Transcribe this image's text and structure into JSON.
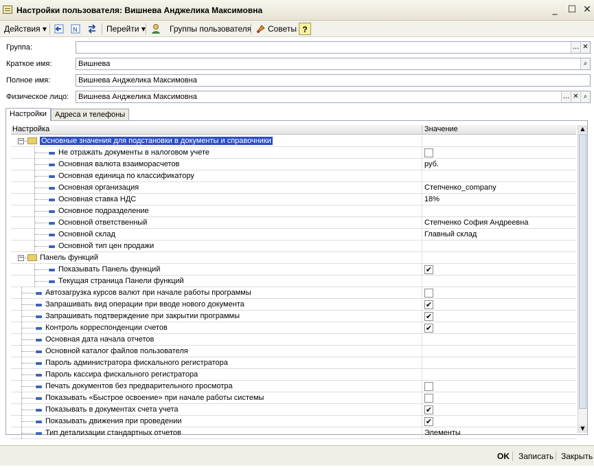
{
  "window": {
    "title": "Настройки пользователя: Вишнева Анджелика Максимовна"
  },
  "toolbar": {
    "actions": "Действия",
    "goto": "Перейти",
    "user_groups": "Группы пользователя",
    "tips": "Советы",
    "help": "?"
  },
  "form": {
    "group": {
      "label": "Группа:",
      "value": ""
    },
    "short_name": {
      "label": "Краткое имя:",
      "value": "Вишнева"
    },
    "full_name": {
      "label": "Полное имя:",
      "value": "Вишнева Анджелика Максимовна"
    },
    "person": {
      "label": "Физическое лицо:",
      "value": "Вишнева Анджелика Максимовна"
    }
  },
  "tabs": [
    "Настройки",
    "Адреса и телефоны"
  ],
  "grid": {
    "columns": [
      "Настройка",
      "Значение"
    ],
    "rows": [
      {
        "name": "Основные значения для подстановки в документы и справочники",
        "value": "",
        "check": null
      },
      {
        "name": "Не отражать документы в налоговом учете",
        "value": "",
        "check": false
      },
      {
        "name": "Основная валюта взаиморасчетов",
        "value": "руб.",
        "check": null
      },
      {
        "name": "Основная единица по классификатору",
        "value": "",
        "check": null
      },
      {
        "name": "Основная организация",
        "value": "Степченко_company",
        "check": null
      },
      {
        "name": "Основная ставка НДС",
        "value": "18%",
        "check": null
      },
      {
        "name": "Основное подразделение",
        "value": "",
        "check": null
      },
      {
        "name": "Основной ответственный",
        "value": "Степченко София Андреевна",
        "check": null
      },
      {
        "name": "Основной склад",
        "value": "Главный склад",
        "check": null
      },
      {
        "name": "Основной тип цен продажи",
        "value": "",
        "check": null
      },
      {
        "name": "Панель функций",
        "value": "",
        "check": null
      },
      {
        "name": "Показывать Панель функций",
        "value": "",
        "check": true
      },
      {
        "name": "Текущая страница Панели функций",
        "value": "",
        "check": null
      },
      {
        "name": "Автозагрузка курсов валют при начале работы программы",
        "value": "",
        "check": false
      },
      {
        "name": "Запрашивать вид операции при вводе нового документа",
        "value": "",
        "check": true
      },
      {
        "name": "Запрашивать подтверждение при закрытии программы",
        "value": "",
        "check": true
      },
      {
        "name": "Контроль корреспонденции счетов",
        "value": "",
        "check": true
      },
      {
        "name": "Основная дата начала отчетов",
        "value": "",
        "check": null
      },
      {
        "name": "Основной каталог файлов пользователя",
        "value": "",
        "check": null
      },
      {
        "name": "Пароль администратора фискального регистратора",
        "value": "",
        "check": null
      },
      {
        "name": "Пароль кассира фискального регистратора",
        "value": "",
        "check": null
      },
      {
        "name": "Печать документов без предварительного просмотра",
        "value": "",
        "check": false
      },
      {
        "name": "Показывать «Быстрое освоение» при начале работы системы",
        "value": "",
        "check": false
      },
      {
        "name": "Показывать в документах счета учета",
        "value": "",
        "check": true
      },
      {
        "name": "Показывать движения при проведении",
        "value": "",
        "check": true
      },
      {
        "name": "Тип детализации стандартных отчетов",
        "value": "Элементы",
        "check": null
      }
    ]
  },
  "buttons": {
    "ok": "OK",
    "save": "Записать",
    "close": "Закрыть"
  },
  "icons": {
    "window": "form-icon",
    "back": "arrow-left-icon",
    "refresh": "refresh-icon",
    "transfer": "exchange-icon",
    "user": "user-icon",
    "tips": "tips-icon",
    "help": "help-icon",
    "select": "ellipsis-icon",
    "clear": "clear-icon",
    "search": "search-icon"
  }
}
